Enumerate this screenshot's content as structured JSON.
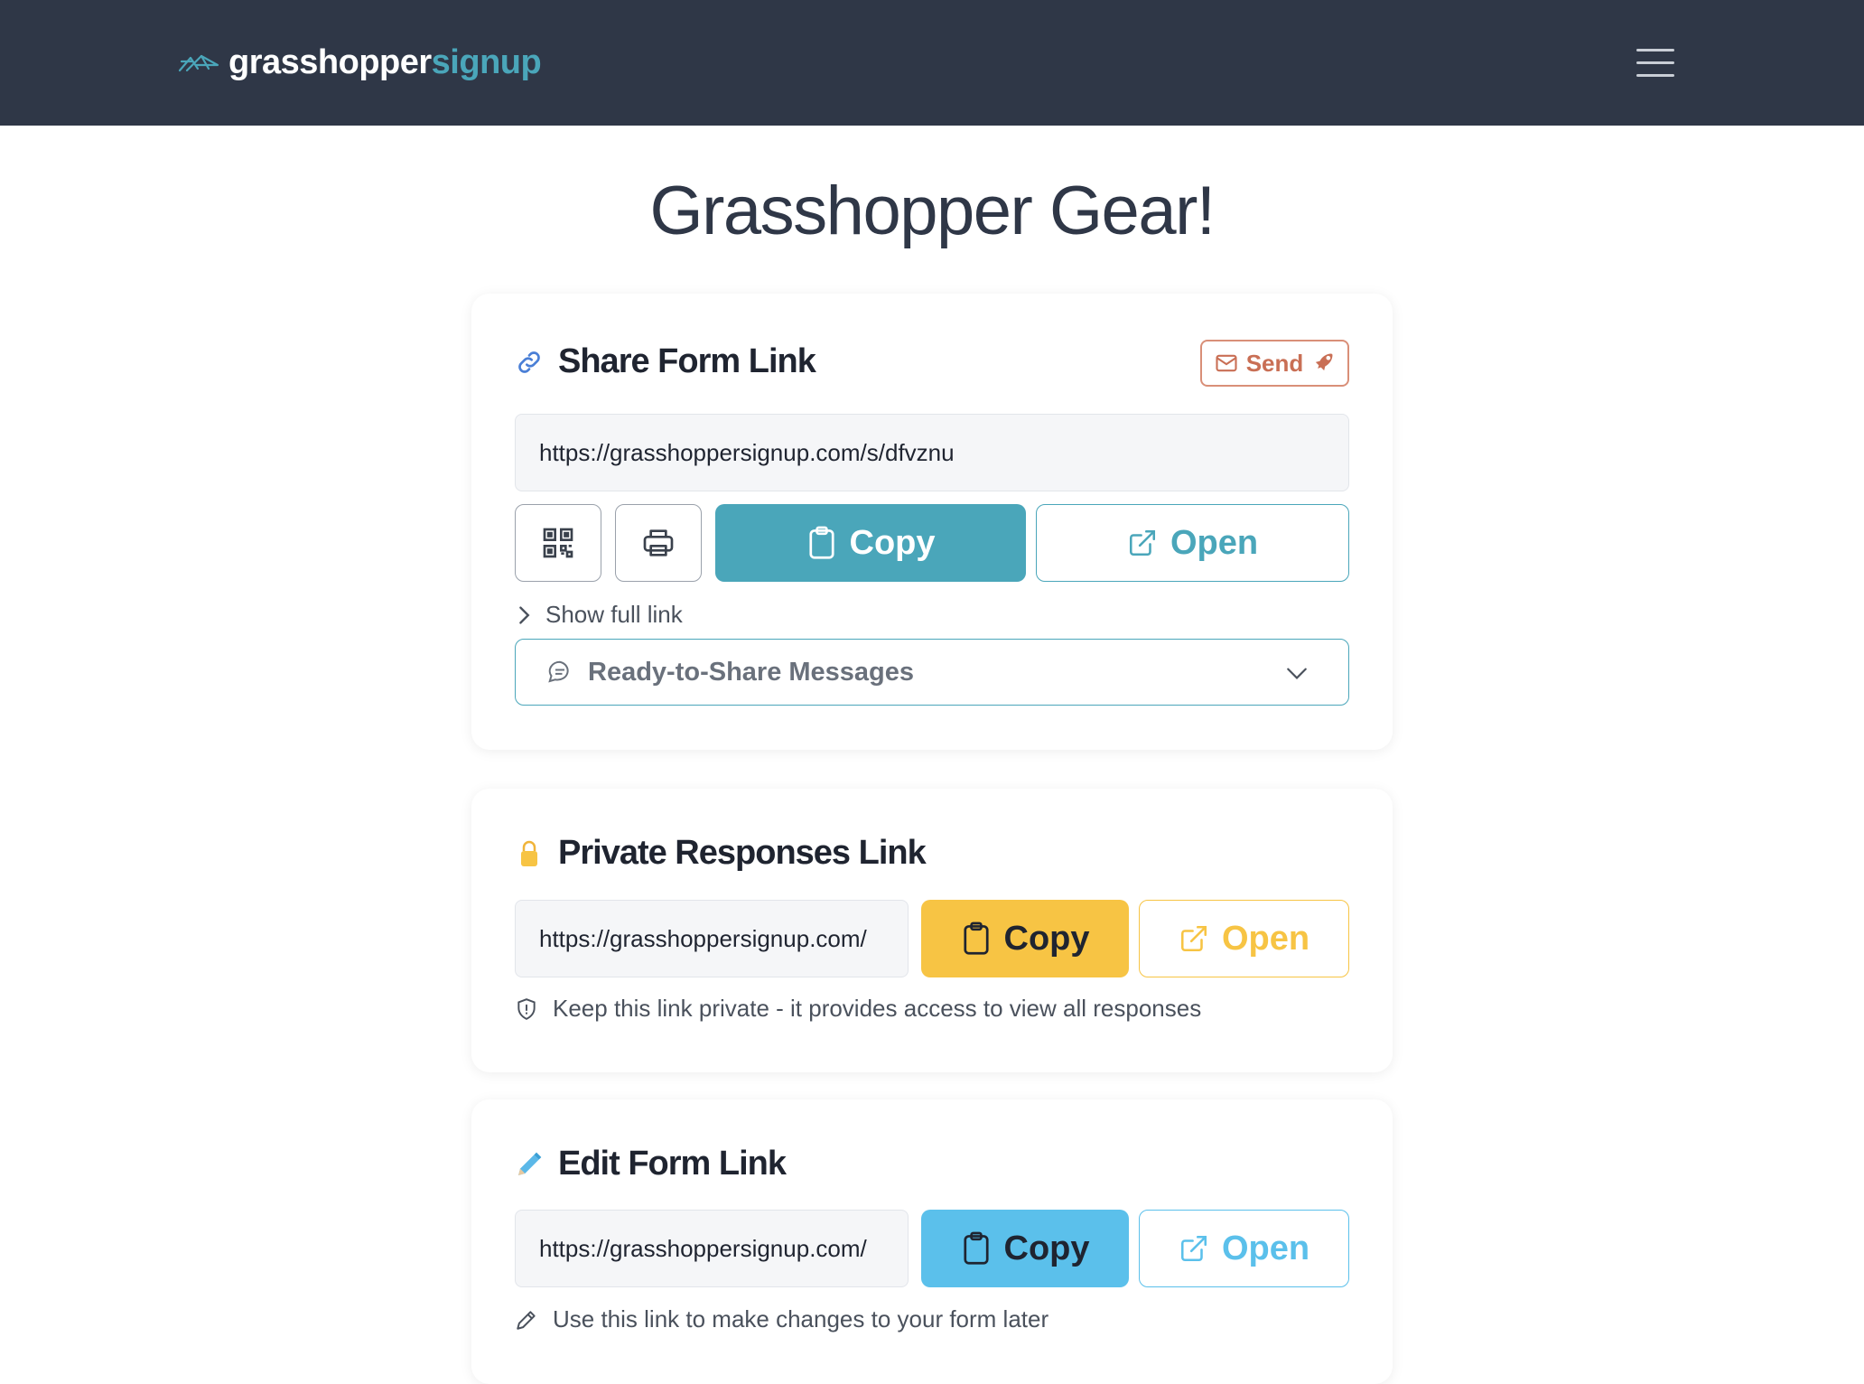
{
  "nav": {
    "logo_part1": "grasshopper",
    "logo_part2": "signup",
    "logo_icon": "grasshopper-icon",
    "menu_icon": "hamburger-menu-icon"
  },
  "page": {
    "title": "Grasshopper Gear!"
  },
  "share": {
    "title": "Share Form Link",
    "icon": "link-icon",
    "send_label": "Send",
    "url": "https://grasshoppersignup.com/s/dfvznu",
    "qr_icon": "qr-code-icon",
    "print_icon": "printer-icon",
    "copy_label": "Copy",
    "open_label": "Open",
    "show_full_link": "Show full link",
    "messages_label": "Ready-to-Share Messages"
  },
  "private": {
    "title": "Private Responses Link",
    "icon": "lock-icon",
    "url": "https://grasshoppersignup.com/",
    "copy_label": "Copy",
    "open_label": "Open",
    "note": "Keep this link private - it provides access to view all responses"
  },
  "edit": {
    "title": "Edit Form Link",
    "icon": "pencil-icon",
    "url": "https://grasshoppersignup.com/",
    "copy_label": "Copy",
    "open_label": "Open",
    "note": "Use this link to make changes to your form later"
  },
  "colors": {
    "navbar": "#2f3747",
    "teal": "#4aa6ba",
    "yellow": "#f7c444",
    "sky": "#5bc0eb",
    "send": "#c96f55"
  }
}
